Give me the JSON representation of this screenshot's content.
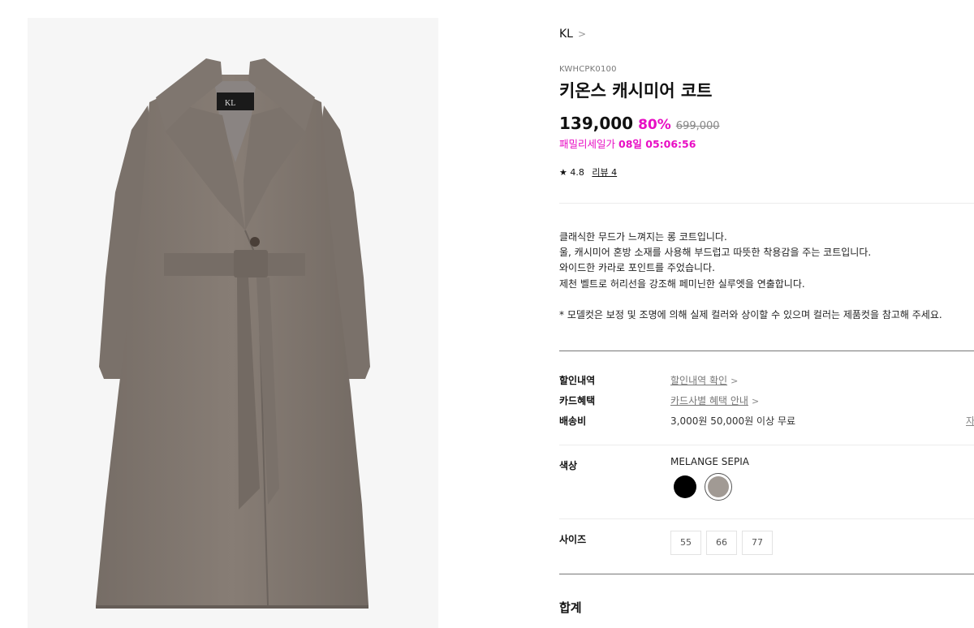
{
  "product": {
    "brand": "KL",
    "code": "KWHCPK0100",
    "name": "키온스 캐시미어 코트",
    "price": "139,000",
    "discount_rate": "80%",
    "original_price": "699,000",
    "sale_label": "패밀리세일가",
    "sale_timer": "08일 05:06:56",
    "rating": "4.8",
    "review_label": "리뷰 4",
    "image_label": "KL"
  },
  "description": {
    "lines": [
      "클래식한 무드가 느껴지는 롱 코트입니다.",
      "울, 캐시미어 혼방 소재를 사용해 부드럽고 따뜻한 착용감을 주는 코트입니다.",
      "와이드한 카라로 포인트를 주었습니다.",
      "제천 벨트로 허리선을 강조해 페미닌한 실루엣을 연출합니다."
    ],
    "note": "* 모델컷은 보정 및 조명에 의해 실제 컬러와 상이할 수 있으며 컬러는 제품컷을 참고해 주세요."
  },
  "info": {
    "discount_label": "할인내역",
    "discount_link": "할인내역 확인",
    "card_label": "카드혜택",
    "card_link": "카드사별 혜택 안내",
    "shipping_label": "배송비",
    "shipping_value": "3,000원 50,000원 이상 무료",
    "shipping_extra": "자"
  },
  "color": {
    "label": "색상",
    "selected": "MELANGE SEPIA",
    "swatches": [
      {
        "name": "BLACK",
        "hex": "#000000",
        "selected": false
      },
      {
        "name": "MELANGE SEPIA",
        "hex": "#a19a94",
        "selected": true
      }
    ]
  },
  "size": {
    "label": "사이즈",
    "options": [
      "55",
      "66",
      "77"
    ]
  },
  "total": {
    "label": "합계"
  },
  "colors": {
    "accent": "#e80ec4",
    "coat": "#847a72"
  }
}
